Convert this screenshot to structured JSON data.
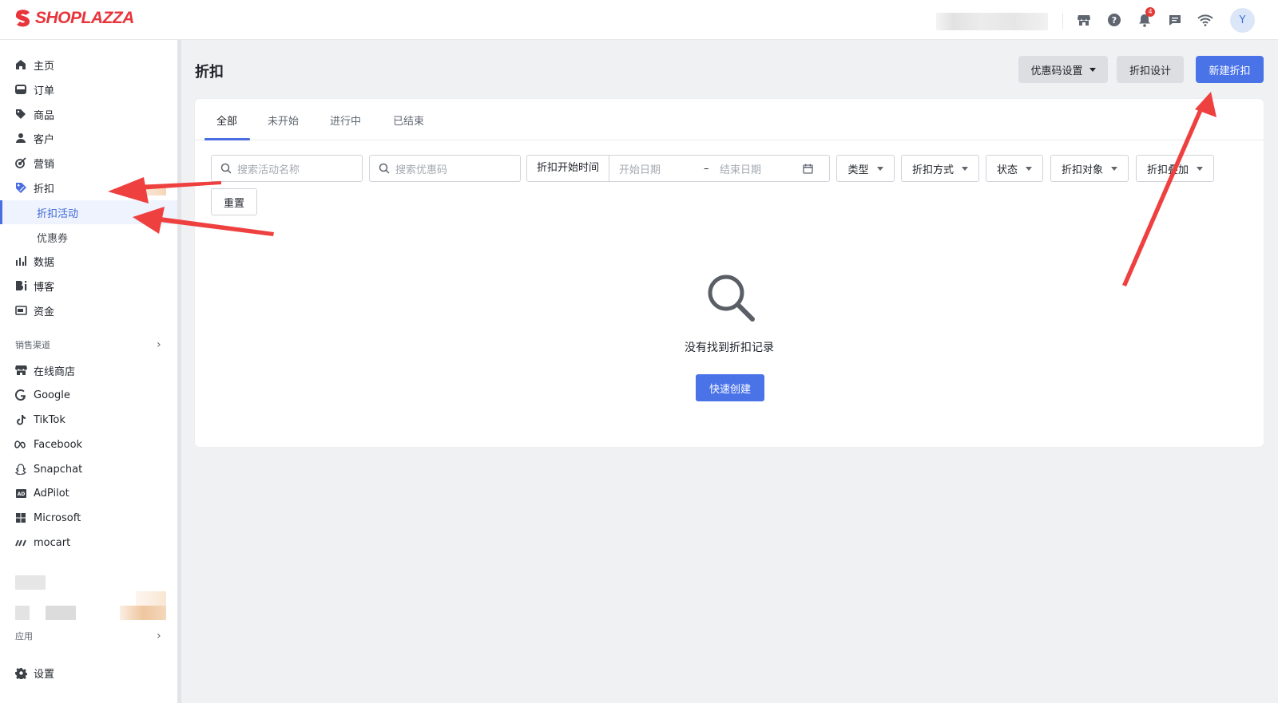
{
  "brand": {
    "name": "SHOPLAZZA",
    "color": "#e8343b"
  },
  "header": {
    "icons": [
      "store-icon",
      "help-icon",
      "bell-icon",
      "message-icon",
      "wifi-icon"
    ],
    "notification_count": "4",
    "avatar_letter": "Y"
  },
  "sidebar": {
    "items": [
      {
        "label": "主页",
        "icon": "home-icon"
      },
      {
        "label": "订单",
        "icon": "inbox-icon"
      },
      {
        "label": "商品",
        "icon": "tag-icon"
      },
      {
        "label": "客户",
        "icon": "person-icon"
      },
      {
        "label": "营销",
        "icon": "target-icon"
      },
      {
        "label": "折扣",
        "icon": "discount-icon"
      },
      {
        "label": "折扣活动",
        "active": true
      },
      {
        "label": "优惠券"
      },
      {
        "label": "数据",
        "icon": "bar-chart-icon"
      },
      {
        "label": "博客",
        "icon": "blog-icon"
      },
      {
        "label": "资金",
        "icon": "wallet-icon"
      }
    ],
    "sales_channels_label": "销售渠道",
    "channels": [
      {
        "label": "在线商店",
        "icon": "store-icon"
      },
      {
        "label": "Google",
        "icon": "google-icon"
      },
      {
        "label": "TikTok",
        "icon": "tiktok-icon"
      },
      {
        "label": "Facebook",
        "icon": "meta-icon"
      },
      {
        "label": "Snapchat",
        "icon": "snapchat-icon"
      },
      {
        "label": "AdPilot",
        "icon": "adpilot-icon"
      },
      {
        "label": "Microsoft",
        "icon": "microsoft-icon"
      },
      {
        "label": "mocart",
        "icon": "mocart-icon"
      }
    ],
    "apps_label": "应用",
    "settings_label": "设置"
  },
  "page": {
    "title": "折扣",
    "coupon_settings_label": "优惠码设置",
    "discount_design_label": "折扣设计",
    "new_discount_label": "新建折扣"
  },
  "tabs": [
    "全部",
    "未开始",
    "进行中",
    "已结束"
  ],
  "filters": {
    "search_name_placeholder": "搜索活动名称",
    "search_code_placeholder": "搜索优惠码",
    "date_label": "折扣开始时间",
    "start_date_placeholder": "开始日期",
    "date_separator": "–",
    "end_date_placeholder": "结束日期",
    "dropdowns": [
      "类型",
      "折扣方式",
      "状态",
      "折扣对象",
      "折扣叠加"
    ],
    "reset_label": "重置"
  },
  "empty_state": {
    "message": "没有找到折扣记录",
    "quick_create_label": "快速创建"
  },
  "colors": {
    "primary": "#4a73e8",
    "annotation_arrow": "#ef4040"
  }
}
